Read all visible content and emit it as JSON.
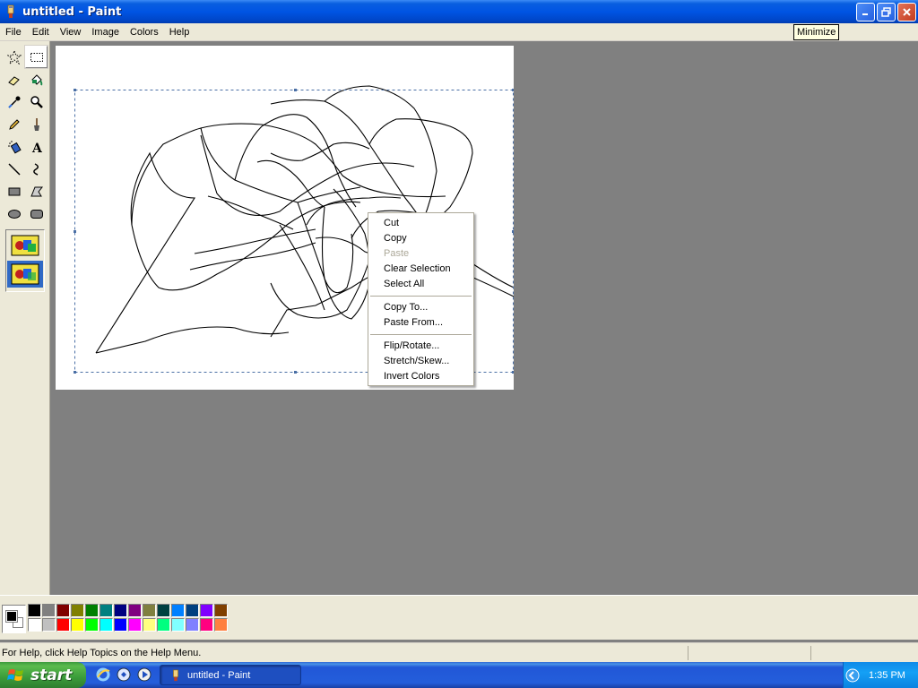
{
  "window": {
    "title": "untitled - Paint",
    "tooltip": "Minimize"
  },
  "menubar": [
    "File",
    "Edit",
    "View",
    "Image",
    "Colors",
    "Help"
  ],
  "toolbox": {
    "tools": [
      "free-form-select",
      "select",
      "eraser",
      "fill-with-color",
      "pick-color",
      "magnifier",
      "pencil",
      "brush",
      "airbrush",
      "text",
      "line",
      "curve",
      "rectangle",
      "polygon",
      "ellipse",
      "rounded-rectangle"
    ],
    "active_tool": "select"
  },
  "context_menu": {
    "groups": [
      [
        {
          "label": "Cut",
          "enabled": true
        },
        {
          "label": "Copy",
          "enabled": true
        },
        {
          "label": "Paste",
          "enabled": false
        },
        {
          "label": "Clear Selection",
          "enabled": true
        },
        {
          "label": "Select All",
          "enabled": true
        }
      ],
      [
        {
          "label": "Copy To...",
          "enabled": true
        },
        {
          "label": "Paste From...",
          "enabled": true
        }
      ],
      [
        {
          "label": "Flip/Rotate...",
          "enabled": true
        },
        {
          "label": "Stretch/Skew...",
          "enabled": true
        },
        {
          "label": "Invert Colors",
          "enabled": true
        }
      ]
    ]
  },
  "palette": {
    "foreground": "#000000",
    "background": "#ffffff",
    "row1": [
      "#000000",
      "#808080",
      "#800000",
      "#808000",
      "#008000",
      "#008080",
      "#000080",
      "#800080",
      "#808040",
      "#004040",
      "#0080ff",
      "#004080",
      "#8000ff",
      "#804000"
    ],
    "row2": [
      "#ffffff",
      "#c0c0c0",
      "#ff0000",
      "#ffff00",
      "#00ff00",
      "#00ffff",
      "#0000ff",
      "#ff00ff",
      "#ffff80",
      "#00ff80",
      "#80ffff",
      "#8080ff",
      "#ff0080",
      "#ff8040"
    ]
  },
  "status": {
    "text": "For Help, click Help Topics on the Help Menu."
  },
  "taskbar": {
    "start_label": "start",
    "task_label": "untitled - Paint",
    "clock": "1:35 PM"
  }
}
